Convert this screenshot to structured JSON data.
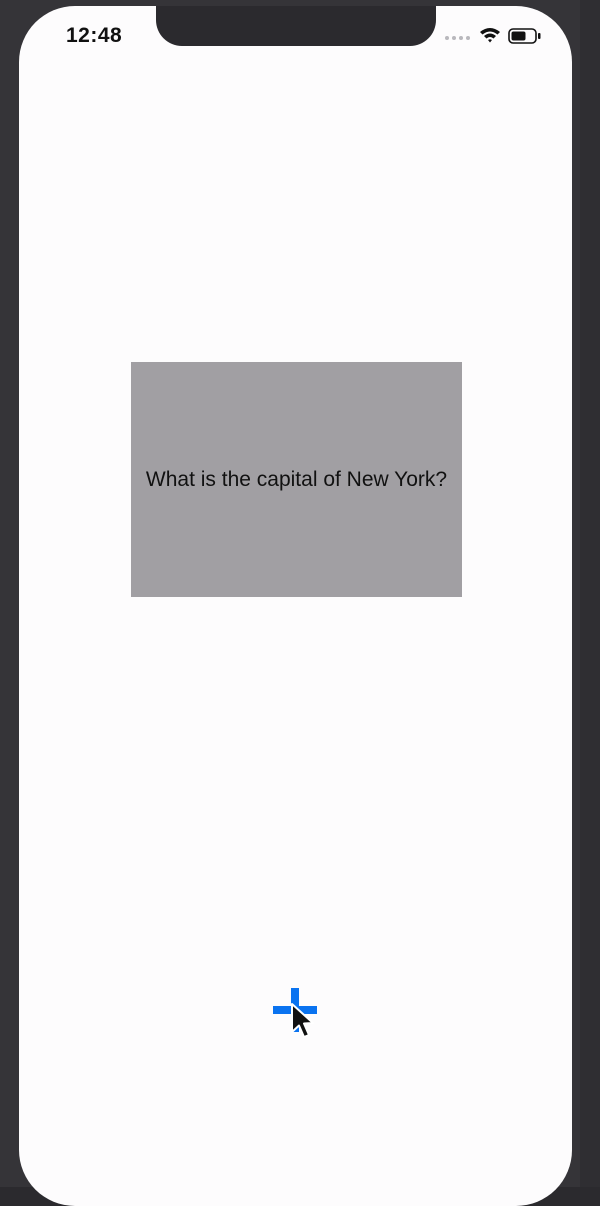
{
  "status_bar": {
    "time": "12:48",
    "icons": [
      "signal-dots-icon",
      "wifi-icon",
      "battery-icon"
    ]
  },
  "card": {
    "question": "What is the capital of New York?",
    "background_color": "#a19fa3"
  },
  "add_button": {
    "icon": "plus-icon",
    "color": "#0a73f0"
  },
  "pointer": {
    "icon": "mouse-cursor-icon"
  }
}
